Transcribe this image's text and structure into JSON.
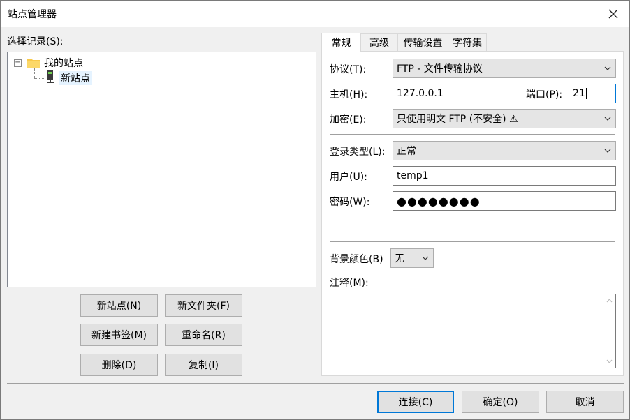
{
  "window": {
    "title": "站点管理器"
  },
  "left": {
    "select_label": "选择记录(S):",
    "tree": {
      "root": "我的站点",
      "child": "新站点"
    },
    "buttons": {
      "new_site": "新站点(N)",
      "new_folder": "新文件夹(F)",
      "new_bookmark": "新建书签(M)",
      "rename": "重命名(R)",
      "delete": "删除(D)",
      "copy": "复制(I)"
    }
  },
  "tabs": [
    "常规",
    "高级",
    "传输设置",
    "字符集"
  ],
  "general": {
    "protocol_label": "协议(T):",
    "protocol_value": "FTP - 文件传输协议",
    "host_label": "主机(H):",
    "host_value": "127.0.0.1",
    "port_label": "端口(P):",
    "port_value": "21",
    "encryption_label": "加密(E):",
    "encryption_value": "只使用明文 FTP (不安全) ⚠",
    "logon_label": "登录类型(L):",
    "logon_value": "正常",
    "user_label": "用户(U):",
    "user_value": "temp1",
    "password_label": "密码(W):",
    "password_value": "●●●●●●●●",
    "bgcolor_label": "背景颜色(B)",
    "bgcolor_value": "无",
    "comments_label": "注释(M):"
  },
  "footer": {
    "connect": "连接(C)",
    "ok": "确定(O)",
    "cancel": "取消"
  }
}
